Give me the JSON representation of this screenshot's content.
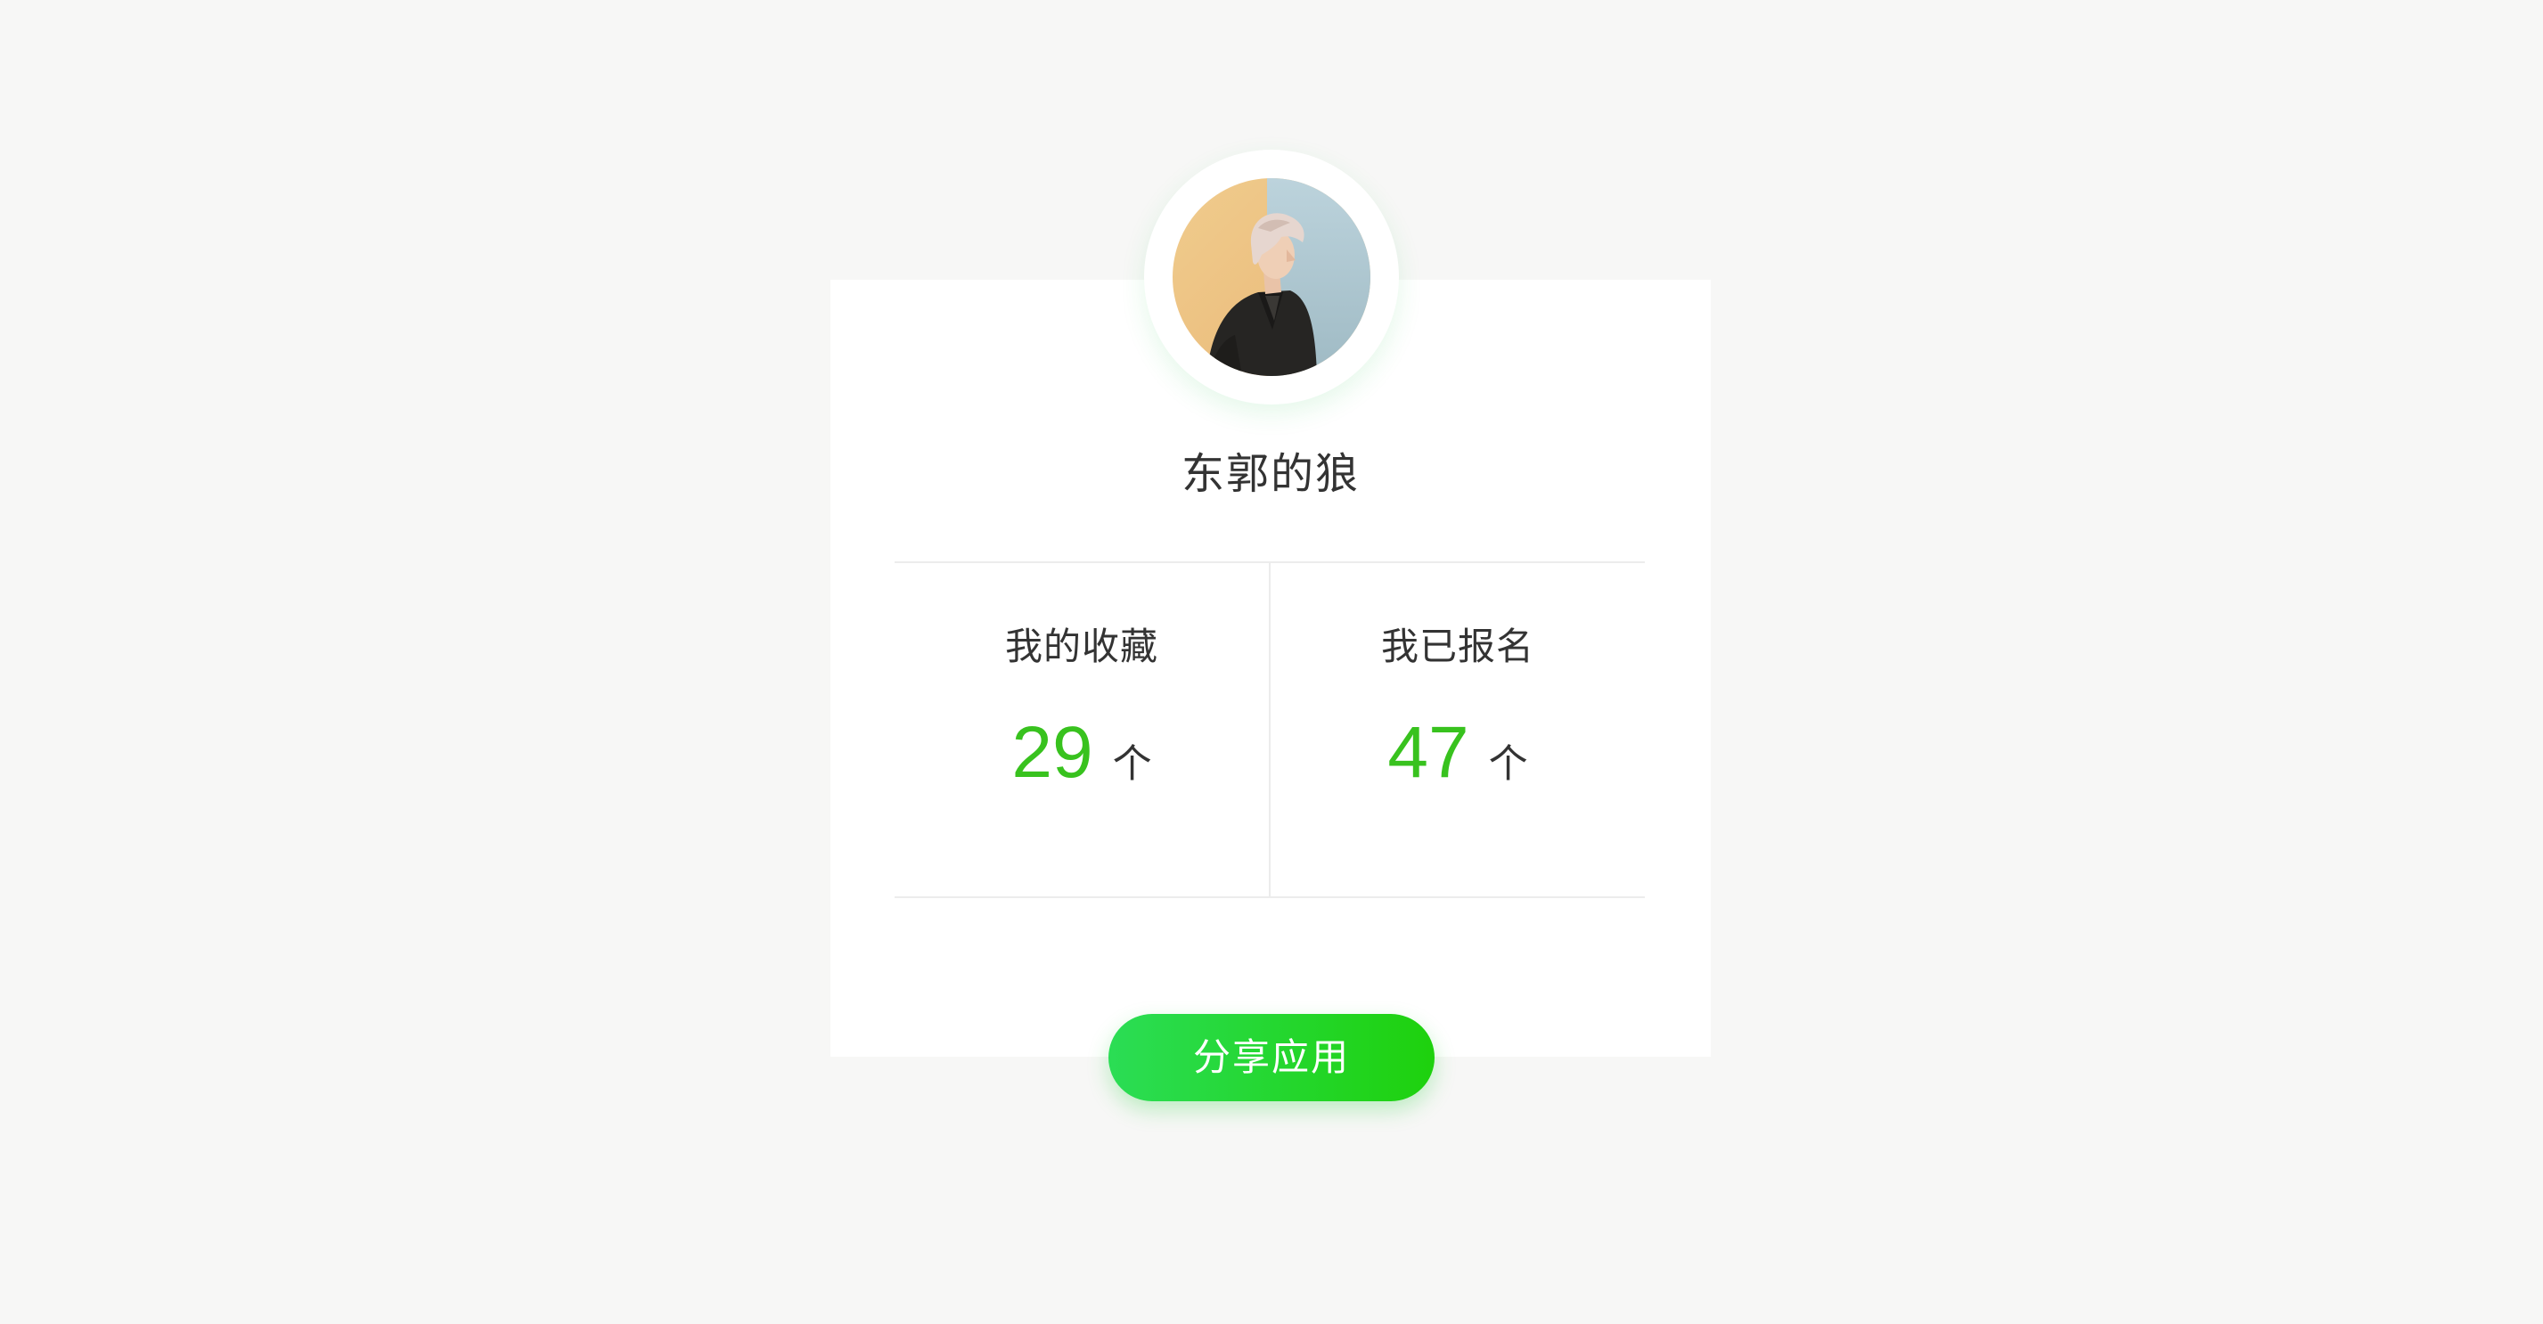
{
  "profile": {
    "username": "东郭的狼"
  },
  "stats": {
    "favorites": {
      "label": "我的收藏",
      "value": "29",
      "unit": "个"
    },
    "registered": {
      "label": "我已报名",
      "value": "47",
      "unit": "个"
    }
  },
  "actions": {
    "share_label": "分享应用"
  },
  "colors": {
    "accent_green": "#38c21e",
    "button_gradient_start": "#2bdd55",
    "button_gradient_end": "#1ed10d",
    "background": "#f7f7f6"
  }
}
